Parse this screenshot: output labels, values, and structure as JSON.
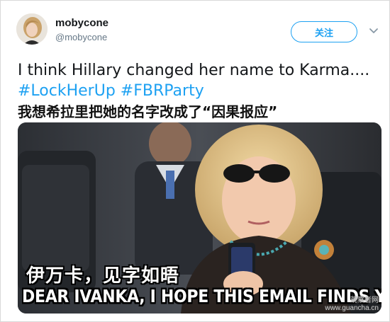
{
  "tweet": {
    "author": {
      "display_name": "mobycone",
      "handle": "@mobycone"
    },
    "follow_label": "关注",
    "text_line1": "I think Hillary changed her name to Karma....",
    "hashtags": [
      "#LockHerUp",
      "#FBRParty"
    ],
    "translation": "我想希拉里把她的名字改成了“因果报应”"
  },
  "media": {
    "caption_zh": "伊万卡，见字如晤",
    "caption_en": "DEAR IVANKA, I HOPE THIS EMAIL FINDS YOU WELL",
    "watermark_line1": "观察者网",
    "watermark_line2": "www.guancha.cn"
  },
  "colors": {
    "accent": "#1da1f2",
    "text": "#14171a",
    "muted": "#657786"
  }
}
